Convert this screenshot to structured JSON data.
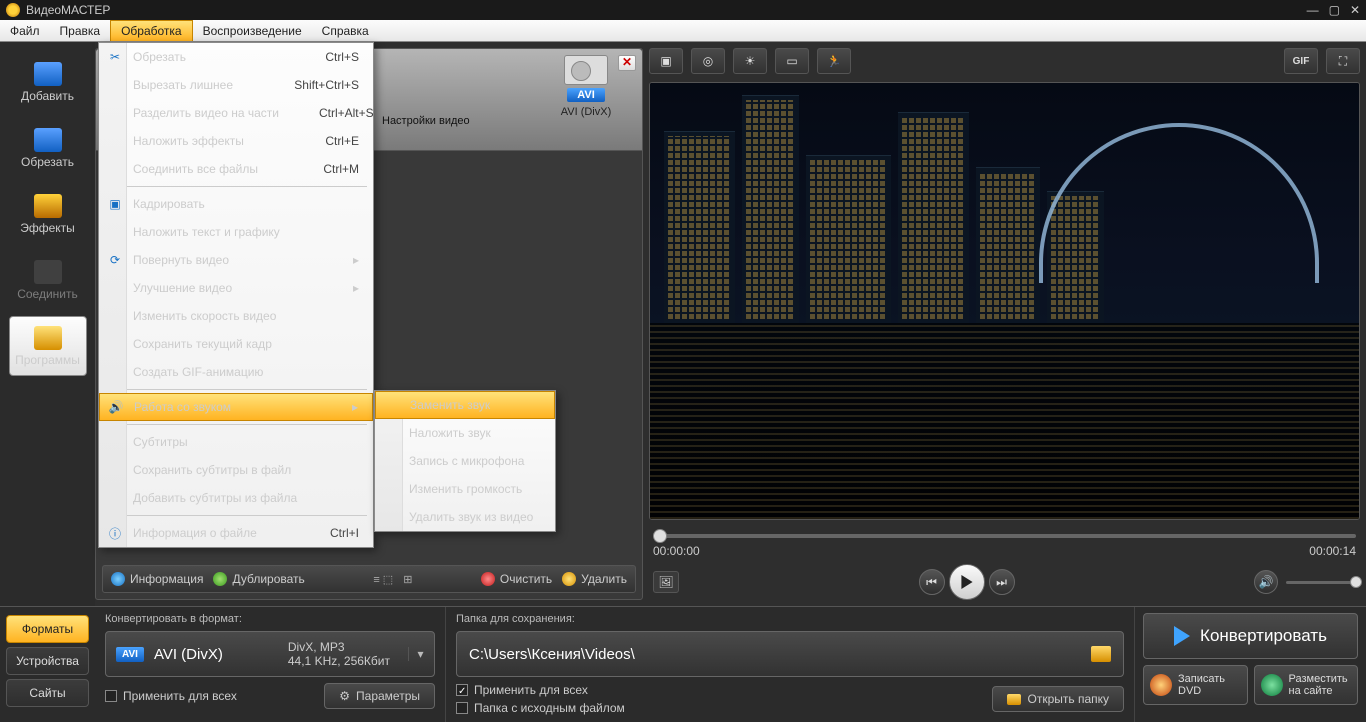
{
  "title": "ВидеоМАСТЕР",
  "menubar": [
    "Файл",
    "Правка",
    "Обработка",
    "Воспроизведение",
    "Справка"
  ],
  "menubar_active_index": 2,
  "sidebar": [
    {
      "label": "Добавить"
    },
    {
      "label": "Обрезать"
    },
    {
      "label": "Эффекты"
    },
    {
      "label": "Соединить",
      "dim": true
    },
    {
      "label": "Программы",
      "sel": true
    }
  ],
  "file_tile": {
    "badge": "AVI",
    "format": "AVI (DivX)"
  },
  "video_settings_label": "Настройки видео",
  "center_toolbar": {
    "info": "Информация",
    "dup": "Дублировать",
    "clear": "Очистить",
    "del": "Удалить"
  },
  "processing_menu": [
    {
      "label": "Обрезать",
      "shortcut": "Ctrl+S",
      "icon": "cut"
    },
    {
      "label": "Вырезать лишнее",
      "shortcut": "Shift+Ctrl+S"
    },
    {
      "label": "Разделить видео на части",
      "shortcut": "Ctrl+Alt+S"
    },
    {
      "label": "Наложить эффекты",
      "shortcut": "Ctrl+E"
    },
    {
      "label": "Соединить все файлы",
      "shortcut": "Ctrl+M",
      "dis": true
    },
    {
      "sep": true
    },
    {
      "label": "Кадрировать",
      "icon": "crop"
    },
    {
      "label": "Наложить текст и графику"
    },
    {
      "label": "Повернуть видео",
      "arrow": true,
      "icon": "rotate"
    },
    {
      "label": "Улучшение видео",
      "arrow": true
    },
    {
      "label": "Изменить скорость видео"
    },
    {
      "label": "Сохранить текущий кадр"
    },
    {
      "label": "Создать GIF-анимацию"
    },
    {
      "sep": true
    },
    {
      "label": "Работа со звуком",
      "arrow": true,
      "sel": true,
      "icon": "sound"
    },
    {
      "sep": true
    },
    {
      "label": "Субтитры",
      "dis": true
    },
    {
      "label": "Сохранить субтитры в файл",
      "dis": true
    },
    {
      "label": "Добавить субтитры из файла"
    },
    {
      "sep": true
    },
    {
      "label": "Информация о файле",
      "shortcut": "Ctrl+I",
      "icon": "info"
    }
  ],
  "sound_submenu": [
    {
      "label": "Заменить звук",
      "sel": true
    },
    {
      "label": "Наложить звук"
    },
    {
      "label": "Запись с микрофона"
    },
    {
      "label": "Изменить громкость"
    },
    {
      "label": "Удалить звук из видео"
    }
  ],
  "preview_tools": [
    "crop",
    "aperture",
    "brightness",
    "frame",
    "run"
  ],
  "preview_tools_right": [
    "GIF",
    "fullscreen"
  ],
  "time": {
    "cur": "00:00:00",
    "dur": "00:00:14"
  },
  "bottom": {
    "tabs": [
      "Форматы",
      "Устройства",
      "Сайты"
    ],
    "convert_label": "Конвертировать в формат:",
    "format": {
      "badge": "AVI",
      "name": "AVI (DivX)",
      "line1": "DivX, MP3",
      "line2": "44,1 KHz, 256Кбит"
    },
    "apply_all": "Применить для всех",
    "params": "Параметры",
    "folder_label": "Папка для сохранения:",
    "path": "C:\\Users\\Ксения\\Videos\\",
    "apply_all2": "Применить для всех",
    "source_folder": "Папка с исходным файлом",
    "open_folder": "Открыть папку",
    "convert": "Конвертировать",
    "dvd": "Записать\nDVD",
    "site": "Разместить\nна сайте"
  }
}
